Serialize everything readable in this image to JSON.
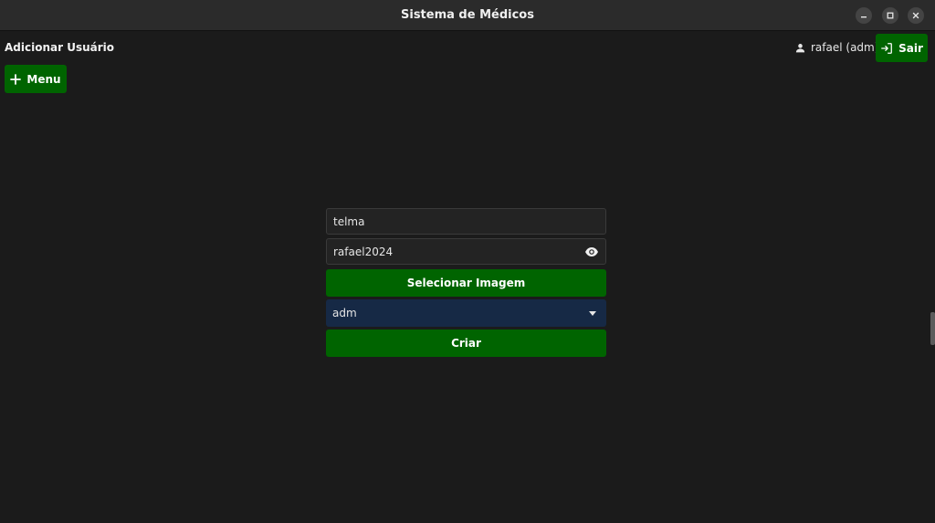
{
  "window": {
    "title": "Sistema de Médicos"
  },
  "header": {
    "page_title": "Adicionar Usuário",
    "user_label": "rafael (adm)",
    "logout_label": "Sair",
    "menu_label": "Menu"
  },
  "form": {
    "username_value": "telma",
    "password_value": "rafael2024",
    "select_image_label": "Selecionar Imagem",
    "role_selected": "adm",
    "create_label": "Criar"
  },
  "icons": {
    "user": "person-icon",
    "logout": "logout-icon",
    "menu": "plus-icon",
    "password_toggle": "eye-icon",
    "dropdown": "caret-down-icon",
    "minimize": "minimize-icon",
    "maximize": "maximize-icon",
    "close": "close-icon"
  },
  "colors": {
    "background": "#1b1b1b",
    "titlebar": "#2b2b2b",
    "accent_green": "#006400",
    "select_background": "#162945",
    "field_background": "#232323"
  }
}
